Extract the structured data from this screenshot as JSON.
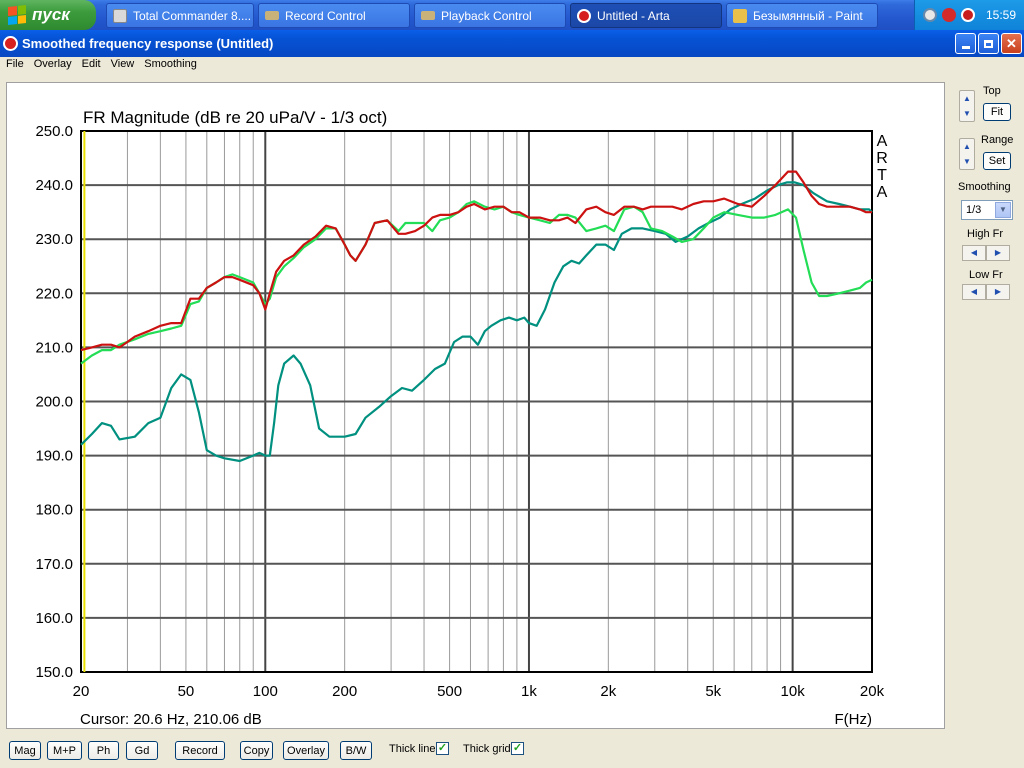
{
  "taskbar": {
    "start_label": "пуск",
    "tasks": [
      {
        "label": "Total Commander 8....",
        "icon": "folder-icon"
      },
      {
        "label": "Record Control",
        "icon": "mixer-icon"
      },
      {
        "label": "Playback Control",
        "icon": "mixer-icon"
      },
      {
        "label": "Untitled - Arta",
        "icon": "arta-icon"
      },
      {
        "label": "Безымянный - Paint",
        "icon": "paint-icon"
      }
    ],
    "clock": "15:59"
  },
  "window": {
    "title": "Smoothed frequency response (Untitled)"
  },
  "menu": [
    "File",
    "Overlay",
    "Edit",
    "View",
    "Smoothing"
  ],
  "chart_data": {
    "type": "line",
    "title": "FR Magnitude (dB re 20 uPa/V - 1/3 oct)",
    "xlabel": "F(Hz)",
    "x_scale": "log",
    "xlim": [
      20,
      20000
    ],
    "ylim": [
      150,
      250
    ],
    "x_ticks": [
      20,
      50,
      100,
      200,
      500,
      1000,
      2000,
      5000,
      10000,
      20000
    ],
    "x_tick_labels": [
      "20",
      "50",
      "100",
      "200",
      "500",
      "1k",
      "2k",
      "5k",
      "10k",
      "20k"
    ],
    "y_ticks": [
      150,
      160,
      170,
      180,
      190,
      200,
      210,
      220,
      230,
      240,
      250
    ],
    "y_tick_labels": [
      "150.0",
      "160.0",
      "170.0",
      "180.0",
      "190.0",
      "200.0",
      "210.0",
      "220.0",
      "230.0",
      "240.0",
      "250.0"
    ],
    "watermark": [
      "A",
      "R",
      "T",
      "A"
    ],
    "cursor_text": "Cursor: 20.6 Hz, 210.06 dB",
    "cursor_x": 20.6,
    "grid": true,
    "series": [
      {
        "color": "#009080",
        "points": [
          [
            20,
            192
          ],
          [
            22,
            194
          ],
          [
            24,
            196
          ],
          [
            26,
            195.5
          ],
          [
            28,
            193
          ],
          [
            32,
            193.5
          ],
          [
            36,
            196
          ],
          [
            40,
            197
          ],
          [
            44,
            202.5
          ],
          [
            48,
            205
          ],
          [
            52,
            204
          ],
          [
            56,
            198
          ],
          [
            60,
            191
          ],
          [
            65,
            190
          ],
          [
            70,
            189.5
          ],
          [
            80,
            189
          ],
          [
            90,
            190
          ],
          [
            95,
            190.5
          ],
          [
            100,
            190
          ],
          [
            104,
            190
          ],
          [
            108,
            196
          ],
          [
            112,
            203
          ],
          [
            118,
            207
          ],
          [
            128,
            208.5
          ],
          [
            136,
            207
          ],
          [
            148,
            203
          ],
          [
            160,
            195
          ],
          [
            175,
            193.5
          ],
          [
            200,
            193.5
          ],
          [
            220,
            194
          ],
          [
            240,
            197
          ],
          [
            270,
            199
          ],
          [
            300,
            201
          ],
          [
            330,
            202.5
          ],
          [
            360,
            202
          ],
          [
            400,
            204
          ],
          [
            440,
            206
          ],
          [
            480,
            207
          ],
          [
            520,
            211
          ],
          [
            560,
            212
          ],
          [
            600,
            212
          ],
          [
            640,
            210.5
          ],
          [
            680,
            213
          ],
          [
            720,
            214
          ],
          [
            780,
            215
          ],
          [
            840,
            215.5
          ],
          [
            900,
            215
          ],
          [
            960,
            215.5
          ],
          [
            1000,
            214.5
          ],
          [
            1070,
            214
          ],
          [
            1150,
            217
          ],
          [
            1250,
            222
          ],
          [
            1350,
            225
          ],
          [
            1450,
            226
          ],
          [
            1550,
            225.5
          ],
          [
            1650,
            227
          ],
          [
            1800,
            229
          ],
          [
            1950,
            229
          ],
          [
            2100,
            228
          ],
          [
            2250,
            231
          ],
          [
            2450,
            232
          ],
          [
            2700,
            232
          ],
          [
            3000,
            231.5
          ],
          [
            3300,
            231
          ],
          [
            3600,
            229.5
          ],
          [
            4000,
            230.5
          ],
          [
            4400,
            232
          ],
          [
            4800,
            233
          ],
          [
            5300,
            234
          ],
          [
            5800,
            235.5
          ],
          [
            6400,
            236.5
          ],
          [
            7200,
            237.5
          ],
          [
            8000,
            239
          ],
          [
            8800,
            240
          ],
          [
            9500,
            240.5
          ],
          [
            10200,
            240.5
          ],
          [
            11000,
            240
          ],
          [
            12000,
            238.5
          ],
          [
            13500,
            237
          ],
          [
            15000,
            236.5
          ],
          [
            16500,
            236
          ],
          [
            18000,
            235.5
          ],
          [
            19500,
            235.5
          ],
          [
            20000,
            235
          ]
        ]
      },
      {
        "color": "#22dd55",
        "points": [
          [
            20,
            207
          ],
          [
            22,
            208.5
          ],
          [
            24,
            209.5
          ],
          [
            26,
            209.5
          ],
          [
            28,
            210.5
          ],
          [
            32,
            211.5
          ],
          [
            36,
            212.5
          ],
          [
            40,
            213
          ],
          [
            44,
            213.5
          ],
          [
            48,
            214
          ],
          [
            52,
            218
          ],
          [
            56,
            218.5
          ],
          [
            60,
            221
          ],
          [
            65,
            222
          ],
          [
            70,
            223
          ],
          [
            75,
            223.5
          ],
          [
            80,
            223
          ],
          [
            90,
            222
          ],
          [
            95,
            220
          ],
          [
            100,
            218
          ],
          [
            104,
            219
          ],
          [
            110,
            223
          ],
          [
            118,
            225
          ],
          [
            128,
            226.5
          ],
          [
            140,
            228.5
          ],
          [
            155,
            230
          ],
          [
            170,
            232
          ],
          [
            185,
            232
          ],
          [
            200,
            229
          ],
          [
            210,
            227
          ],
          [
            220,
            226
          ],
          [
            240,
            229
          ],
          [
            260,
            233
          ],
          [
            290,
            233.5
          ],
          [
            320,
            231.5
          ],
          [
            340,
            233
          ],
          [
            370,
            233
          ],
          [
            400,
            233
          ],
          [
            430,
            231.5
          ],
          [
            460,
            233.5
          ],
          [
            500,
            234
          ],
          [
            540,
            235
          ],
          [
            580,
            236.5
          ],
          [
            620,
            237
          ],
          [
            680,
            236
          ],
          [
            740,
            235.5
          ],
          [
            800,
            236
          ],
          [
            860,
            235
          ],
          [
            920,
            234.5
          ],
          [
            1000,
            234
          ],
          [
            1100,
            233.5
          ],
          [
            1200,
            233
          ],
          [
            1300,
            234.5
          ],
          [
            1400,
            234.5
          ],
          [
            1500,
            234
          ],
          [
            1650,
            231.5
          ],
          [
            1800,
            232
          ],
          [
            1950,
            232.5
          ],
          [
            2100,
            231.5
          ],
          [
            2300,
            235.5
          ],
          [
            2500,
            236
          ],
          [
            2700,
            235
          ],
          [
            2900,
            232
          ],
          [
            3200,
            231.5
          ],
          [
            3500,
            230.5
          ],
          [
            3800,
            229.5
          ],
          [
            4200,
            230
          ],
          [
            4600,
            232
          ],
          [
            5000,
            234
          ],
          [
            5500,
            235
          ],
          [
            6200,
            234.5
          ],
          [
            7000,
            234
          ],
          [
            7800,
            234
          ],
          [
            8600,
            234.5
          ],
          [
            9600,
            235.5
          ],
          [
            10300,
            234
          ],
          [
            11000,
            228
          ],
          [
            11800,
            222
          ],
          [
            12600,
            219.5
          ],
          [
            13500,
            219.5
          ],
          [
            15000,
            220
          ],
          [
            16500,
            220.5
          ],
          [
            18000,
            221
          ],
          [
            19000,
            222
          ],
          [
            20000,
            222.5
          ]
        ]
      },
      {
        "color": "#cc1111",
        "points": [
          [
            20,
            209.5
          ],
          [
            22,
            210
          ],
          [
            24,
            210.5
          ],
          [
            26,
            210.5
          ],
          [
            28,
            210
          ],
          [
            30,
            211
          ],
          [
            32,
            212
          ],
          [
            36,
            213
          ],
          [
            40,
            214
          ],
          [
            44,
            214.5
          ],
          [
            48,
            214.5
          ],
          [
            52,
            219
          ],
          [
            56,
            219
          ],
          [
            60,
            221
          ],
          [
            65,
            222
          ],
          [
            70,
            223
          ],
          [
            75,
            223
          ],
          [
            80,
            222.5
          ],
          [
            90,
            221.5
          ],
          [
            95,
            220
          ],
          [
            100,
            217
          ],
          [
            104,
            220
          ],
          [
            110,
            224
          ],
          [
            118,
            226
          ],
          [
            128,
            227
          ],
          [
            140,
            229
          ],
          [
            155,
            230.5
          ],
          [
            170,
            232.5
          ],
          [
            185,
            232
          ],
          [
            200,
            229
          ],
          [
            210,
            227
          ],
          [
            220,
            226
          ],
          [
            240,
            229
          ],
          [
            260,
            233
          ],
          [
            290,
            233.5
          ],
          [
            320,
            231
          ],
          [
            340,
            231
          ],
          [
            370,
            231.5
          ],
          [
            400,
            232.5
          ],
          [
            430,
            234
          ],
          [
            460,
            234.5
          ],
          [
            500,
            234.5
          ],
          [
            540,
            235
          ],
          [
            580,
            236
          ],
          [
            620,
            236.5
          ],
          [
            680,
            235.5
          ],
          [
            740,
            236
          ],
          [
            800,
            236
          ],
          [
            860,
            235
          ],
          [
            920,
            235
          ],
          [
            1000,
            234
          ],
          [
            1100,
            234
          ],
          [
            1200,
            233.5
          ],
          [
            1300,
            233.5
          ],
          [
            1400,
            234
          ],
          [
            1500,
            233
          ],
          [
            1650,
            235.5
          ],
          [
            1800,
            236
          ],
          [
            1950,
            235
          ],
          [
            2100,
            234.5
          ],
          [
            2300,
            236
          ],
          [
            2500,
            236
          ],
          [
            2700,
            235.5
          ],
          [
            2900,
            236
          ],
          [
            3200,
            236
          ],
          [
            3500,
            236
          ],
          [
            3800,
            235.5
          ],
          [
            4200,
            236.5
          ],
          [
            4600,
            237
          ],
          [
            5000,
            237
          ],
          [
            5500,
            237.5
          ],
          [
            6200,
            236.5
          ],
          [
            7000,
            236
          ],
          [
            7800,
            238
          ],
          [
            8600,
            240
          ],
          [
            9600,
            242.5
          ],
          [
            10300,
            242.5
          ],
          [
            11000,
            240.5
          ],
          [
            11800,
            238
          ],
          [
            12600,
            236.5
          ],
          [
            13500,
            236
          ],
          [
            15000,
            236
          ],
          [
            16500,
            236
          ],
          [
            18000,
            235.5
          ],
          [
            19000,
            235
          ],
          [
            20000,
            235
          ]
        ]
      }
    ]
  },
  "right_panel": {
    "top_label": "Top",
    "fit_label": "Fit",
    "range_label": "Range",
    "set_label": "Set",
    "smoothing_label": "Smoothing",
    "smoothing_value": "1/3",
    "high_fr_label": "High Fr",
    "low_fr_label": "Low Fr"
  },
  "bottom": {
    "buttons": [
      "Mag",
      "M+P",
      "Ph",
      "Gd",
      "Record",
      "Copy",
      "Overlay",
      "B/W"
    ],
    "thick_line_label": "Thick line",
    "thick_line_checked": true,
    "thick_grid_label": "Thick grid",
    "thick_grid_checked": true
  }
}
